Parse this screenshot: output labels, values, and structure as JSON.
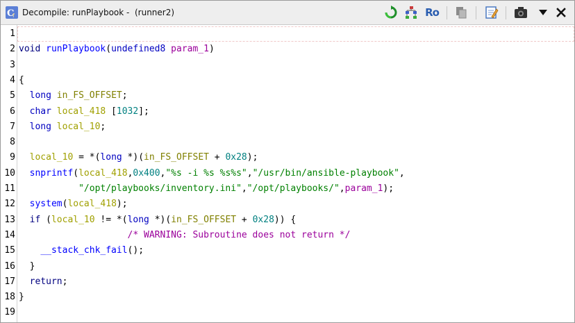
{
  "window": {
    "title": "Decompile: runPlaybook -  (runner2)"
  },
  "toolbar": {
    "items": [
      {
        "name": "refresh",
        "icon": "refresh-icon"
      },
      {
        "name": "structure",
        "icon": "function-graph-icon"
      },
      {
        "name": "read-only",
        "label": "Ro",
        "icon": "readonly-text"
      },
      {
        "name": "copy",
        "icon": "copy-icon"
      },
      {
        "name": "edit",
        "icon": "edit-function-icon"
      },
      {
        "name": "snapshot",
        "icon": "camera-icon"
      },
      {
        "name": "menu",
        "icon": "chevron-down-icon"
      },
      {
        "name": "close",
        "icon": "close-icon"
      }
    ]
  },
  "colors": {
    "keyword": "#000080",
    "type": "#0000c0",
    "function": "#0000ff",
    "global": "#808000",
    "local": "#a0a000",
    "param": "#9b009b",
    "constant": "#008080",
    "string": "#008000",
    "comment": "#9b009b"
  },
  "code": {
    "lines": [
      {
        "n": "1",
        "tokens": []
      },
      {
        "n": "2",
        "tokens": [
          [
            "kw",
            "void"
          ],
          [
            "pn",
            " "
          ],
          [
            "fn",
            "runPlaybook"
          ],
          [
            "pn",
            "("
          ],
          [
            "ty",
            "undefined8"
          ],
          [
            "pn",
            " "
          ],
          [
            "pv",
            "param_1"
          ],
          [
            "pn",
            ")"
          ]
        ]
      },
      {
        "n": "3",
        "tokens": []
      },
      {
        "n": "4",
        "tokens": [
          [
            "pn",
            "{"
          ]
        ]
      },
      {
        "n": "5",
        "tokens": [
          [
            "pn",
            "  "
          ],
          [
            "ty",
            "long"
          ],
          [
            "pn",
            " "
          ],
          [
            "gv",
            "in_FS_OFFSET"
          ],
          [
            "pn",
            ";"
          ]
        ]
      },
      {
        "n": "6",
        "tokens": [
          [
            "pn",
            "  "
          ],
          [
            "ty",
            "char"
          ],
          [
            "pn",
            " "
          ],
          [
            "lv",
            "local_418"
          ],
          [
            "pn",
            " ["
          ],
          [
            "cs",
            "1032"
          ],
          [
            "pn",
            "];"
          ]
        ]
      },
      {
        "n": "7",
        "tokens": [
          [
            "pn",
            "  "
          ],
          [
            "ty",
            "long"
          ],
          [
            "pn",
            " "
          ],
          [
            "lv",
            "local_10"
          ],
          [
            "pn",
            ";"
          ]
        ]
      },
      {
        "n": "8",
        "tokens": []
      },
      {
        "n": "9",
        "tokens": [
          [
            "pn",
            "  "
          ],
          [
            "lv",
            "local_10"
          ],
          [
            "pn",
            " = *("
          ],
          [
            "ty",
            "long"
          ],
          [
            "pn",
            " *)("
          ],
          [
            "gv",
            "in_FS_OFFSET"
          ],
          [
            "pn",
            " + "
          ],
          [
            "cs",
            "0x28"
          ],
          [
            "pn",
            ");"
          ]
        ]
      },
      {
        "n": "10",
        "tokens": [
          [
            "pn",
            "  "
          ],
          [
            "fn",
            "snprintf"
          ],
          [
            "pn",
            "("
          ],
          [
            "lv",
            "local_418"
          ],
          [
            "pn",
            ","
          ],
          [
            "cs",
            "0x400"
          ],
          [
            "pn",
            ","
          ],
          [
            "st",
            "\"%s -i %s %s%s\""
          ],
          [
            "pn",
            ","
          ],
          [
            "st",
            "\"/usr/bin/ansible-playbook\""
          ],
          [
            "pn",
            ","
          ]
        ]
      },
      {
        "n": "11",
        "tokens": [
          [
            "pn",
            "           "
          ],
          [
            "st",
            "\"/opt/playbooks/inventory.ini\""
          ],
          [
            "pn",
            ","
          ],
          [
            "st",
            "\"/opt/playbooks/\""
          ],
          [
            "pn",
            ","
          ],
          [
            "pv",
            "param_1"
          ],
          [
            "pn",
            ");"
          ]
        ]
      },
      {
        "n": "12",
        "tokens": [
          [
            "pn",
            "  "
          ],
          [
            "fn",
            "system"
          ],
          [
            "pn",
            "("
          ],
          [
            "lv",
            "local_418"
          ],
          [
            "pn",
            ");"
          ]
        ]
      },
      {
        "n": "13",
        "tokens": [
          [
            "pn",
            "  "
          ],
          [
            "kw",
            "if"
          ],
          [
            "pn",
            " ("
          ],
          [
            "lv",
            "local_10"
          ],
          [
            "pn",
            " != *("
          ],
          [
            "ty",
            "long"
          ],
          [
            "pn",
            " *)("
          ],
          [
            "gv",
            "in_FS_OFFSET"
          ],
          [
            "pn",
            " + "
          ],
          [
            "cs",
            "0x28"
          ],
          [
            "pn",
            ")) {"
          ]
        ]
      },
      {
        "n": "14",
        "tokens": [
          [
            "pn",
            "                    "
          ],
          [
            "cm",
            "/* WARNING: Subroutine does not return */"
          ]
        ]
      },
      {
        "n": "15",
        "tokens": [
          [
            "pn",
            "    "
          ],
          [
            "fn",
            "__stack_chk_fail"
          ],
          [
            "pn",
            "();"
          ]
        ]
      },
      {
        "n": "16",
        "tokens": [
          [
            "pn",
            "  }"
          ]
        ]
      },
      {
        "n": "17",
        "tokens": [
          [
            "pn",
            "  "
          ],
          [
            "kw",
            "return"
          ],
          [
            "pn",
            ";"
          ]
        ]
      },
      {
        "n": "18",
        "tokens": [
          [
            "pn",
            "}"
          ]
        ]
      },
      {
        "n": "19",
        "tokens": []
      }
    ]
  }
}
